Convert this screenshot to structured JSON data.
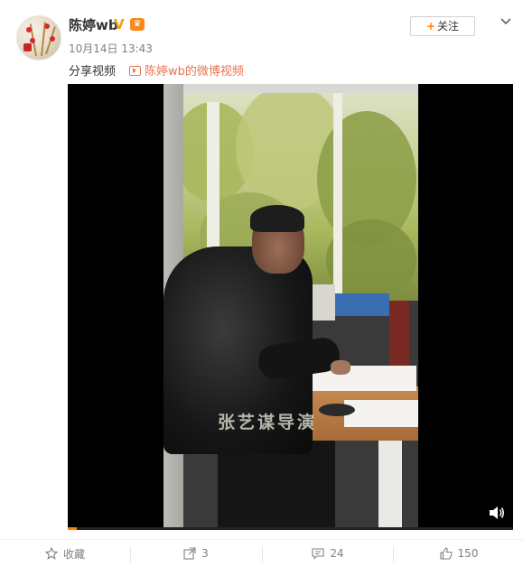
{
  "post": {
    "username": "陈婷wb",
    "verified_mark": "V",
    "vip_badge": "♛",
    "time": "10月14日 13:43",
    "follow_button": "关注",
    "text": "分享视频",
    "video_link": "陈婷wb的微博视频"
  },
  "video": {
    "watermark": "张艺谋导演",
    "progress": 0.02,
    "icons": [
      "volume-icon"
    ]
  },
  "actions": [
    {
      "icon": "star-icon",
      "label": "收藏"
    },
    {
      "icon": "share-icon",
      "label": "3"
    },
    {
      "icon": "comment-icon",
      "label": "24"
    },
    {
      "icon": "like-icon",
      "label": "150"
    }
  ],
  "colors": {
    "accent": "#ff8200",
    "link": "#eb7350",
    "verify": "#f2a400",
    "text_gray": "#808080"
  }
}
